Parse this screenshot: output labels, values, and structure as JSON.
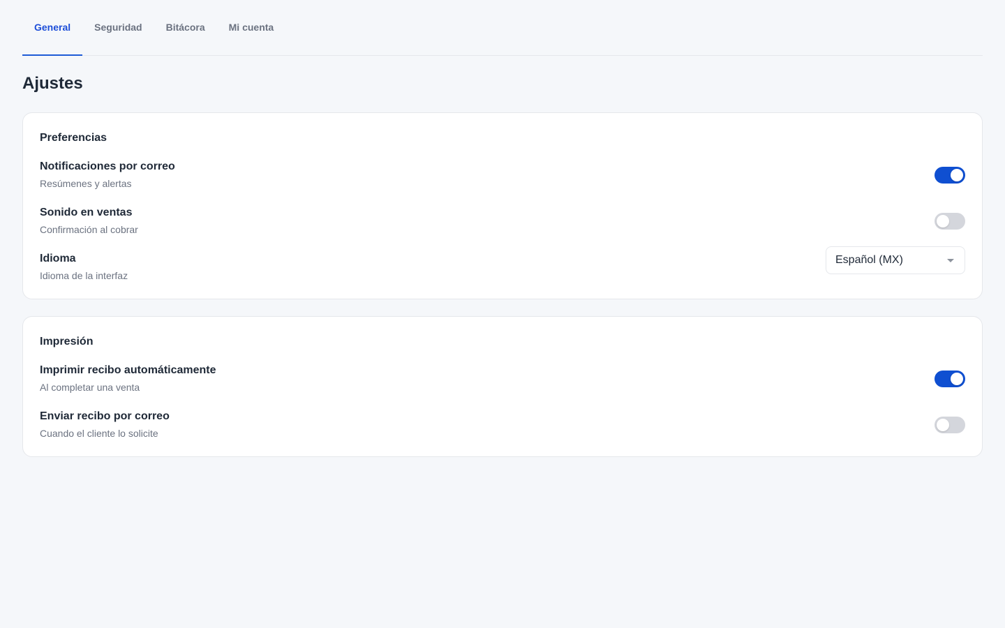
{
  "tabs": [
    {
      "label": "General",
      "active": true
    },
    {
      "label": "Seguridad",
      "active": false
    },
    {
      "label": "Bitácora",
      "active": false
    },
    {
      "label": "Mi cuenta",
      "active": false
    }
  ],
  "page_title": "Ajustes",
  "sections": [
    {
      "title": "Preferencias",
      "rows": [
        {
          "label": "Notificaciones por correo",
          "description": "Resúmenes y alertas",
          "control": "toggle",
          "on": true
        },
        {
          "label": "Sonido en ventas",
          "description": "Confirmación al cobrar",
          "control": "toggle",
          "on": false
        },
        {
          "label": "Idioma",
          "description": "Idioma de la interfaz",
          "control": "select",
          "value": "Español (MX)",
          "icon": "chevron-down-icon"
        }
      ]
    },
    {
      "title": "Impresión",
      "rows": [
        {
          "label": "Imprimir recibo automáticamente",
          "description": "Al completar una venta",
          "control": "toggle",
          "on": true
        },
        {
          "label": "Enviar recibo por correo",
          "description": "Cuando el cliente lo solicite",
          "control": "toggle",
          "on": false
        }
      ]
    }
  ],
  "colors": {
    "accent": "#0f4fd1",
    "toggle_off": "#d4d6dc",
    "background": "#f5f7fa"
  }
}
